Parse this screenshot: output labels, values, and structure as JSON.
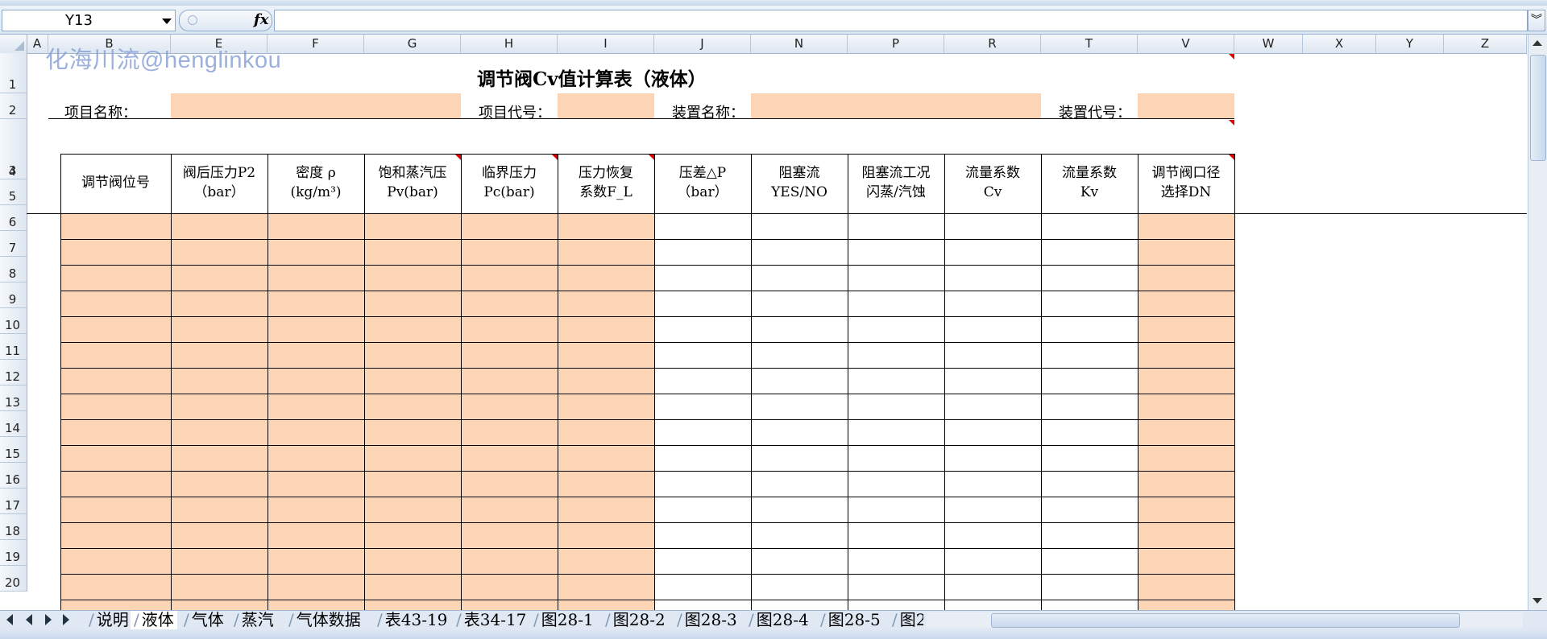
{
  "formula_bar": {
    "cell_ref": "Y13",
    "fx_label": "fx",
    "expand_icon": "double-chevron-down"
  },
  "column_headers": [
    "A",
    "B",
    "E",
    "F",
    "G",
    "H",
    "I",
    "J",
    "N",
    "P",
    "R",
    "T",
    "V",
    "W",
    "X",
    "Y",
    "Z"
  ],
  "row_headers": [
    "1",
    "2",
    "3",
    "4",
    "5",
    "6",
    "7",
    "8",
    "9",
    "10",
    "11",
    "12",
    "13",
    "14",
    "15",
    "16",
    "17",
    "18",
    "19",
    "20"
  ],
  "sheet": {
    "watermark": "化海川流@henglinkou",
    "title": "调节阀Cv值计算表（液体）",
    "labels": {
      "project_name": "项目名称：",
      "project_code": "项目代号：",
      "unit_name": "装置名称：",
      "unit_code": "装置代号："
    },
    "table_headers": [
      {
        "line1": "调节阀位号",
        "line2": ""
      },
      {
        "line1": "阀后压力P2",
        "line2": "（bar）"
      },
      {
        "line1": "密度 ρ",
        "line2": "(kg/m³)"
      },
      {
        "line1": "饱和蒸汽压",
        "line2": "Pv(bar)"
      },
      {
        "line1": "临界压力",
        "line2": "Pc(bar)"
      },
      {
        "line1": "压力恢复",
        "line2": "系数F_L"
      },
      {
        "line1": "压差△P",
        "line2": "（bar）"
      },
      {
        "line1": "阻塞流",
        "line2": "YES/NO"
      },
      {
        "line1": "阻塞流工况",
        "line2": "闪蒸/汽蚀"
      },
      {
        "line1": "流量系数",
        "line2": "Cv"
      },
      {
        "line1": "流量系数",
        "line2": "Kv"
      },
      {
        "line1": "调节阀口径",
        "line2": "选择DN"
      }
    ]
  },
  "sheet_tabs": [
    "说明",
    "液体",
    "气体",
    "蒸汽",
    "气体数据",
    "表43-19",
    "表34-17",
    "图28-1",
    "图28-2",
    "图28-3",
    "图28-4",
    "图28-5",
    "图2"
  ],
  "active_tab": "液体",
  "colors": {
    "input_fill": "#fcd5b4",
    "header_bg": "#dde6f1",
    "watermark": "#8aa3d6",
    "comment_marker": "#dd0000"
  }
}
